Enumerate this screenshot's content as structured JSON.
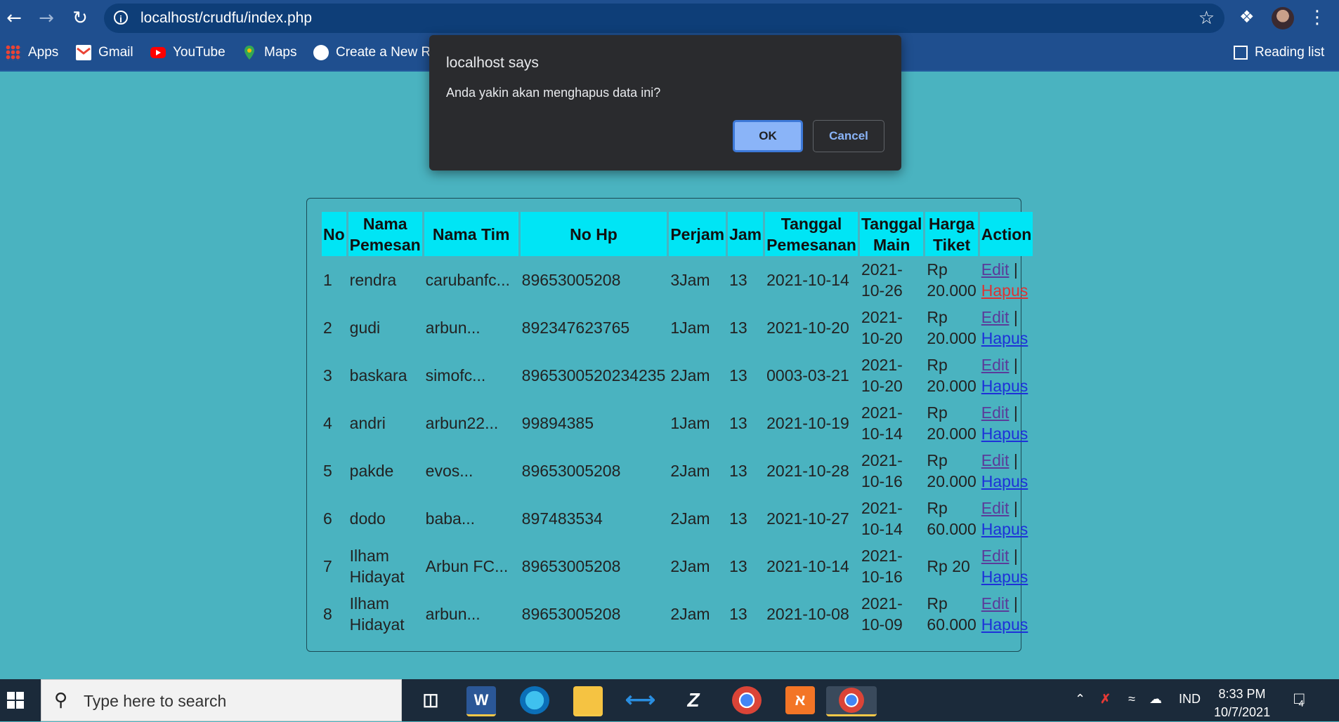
{
  "browser": {
    "url": "localhost/crudfu/index.php",
    "back_icon": "arrow-left-icon",
    "forward_icon": "arrow-right-icon",
    "reload_icon": "reload-icon"
  },
  "bookmarks": {
    "items": [
      {
        "label": "Apps",
        "icon": "apps-grid-icon"
      },
      {
        "label": "Gmail",
        "icon": "gmail-icon"
      },
      {
        "label": "YouTube",
        "icon": "youtube-icon"
      },
      {
        "label": "Maps",
        "icon": "maps-icon"
      },
      {
        "label": "Create a New Re",
        "icon": "github-icon"
      }
    ],
    "reading_list": "Reading list"
  },
  "dialog": {
    "title": "localhost says",
    "message": "Anda yakin akan menghapus data ini?",
    "ok_label": "OK",
    "cancel_label": "Cancel"
  },
  "table": {
    "headers": [
      "No",
      "Nama Pemesan",
      "Nama Tim",
      "No Hp",
      "Perjam",
      "Jam",
      "Tanggal Pemesanan",
      "Tanggal Main",
      "Harga Tiket",
      "Action"
    ],
    "edit_label": "Edit",
    "separator": "|",
    "hapus_label": "Hapus",
    "rows": [
      {
        "no": "1",
        "nama": "rendra",
        "tim": "carubanfc...",
        "hp": "89653005208",
        "perjam": "3Jam",
        "jam": "13",
        "tgl_pesan": "2021-10-14",
        "tgl_main_a": "2021-",
        "tgl_main_b": "10-26",
        "harga_a": "Rp",
        "harga_b": "20.000"
      },
      {
        "no": "2",
        "nama": "gudi",
        "tim": "arbun...",
        "hp": "892347623765",
        "perjam": "1Jam",
        "jam": "13",
        "tgl_pesan": "2021-10-20",
        "tgl_main_a": "2021-",
        "tgl_main_b": "10-20",
        "harga_a": "Rp",
        "harga_b": "20.000"
      },
      {
        "no": "3",
        "nama": "baskara",
        "tim": "simofc...",
        "hp": "8965300520234235",
        "perjam": "2Jam",
        "jam": "13",
        "tgl_pesan": "0003-03-21",
        "tgl_main_a": "2021-",
        "tgl_main_b": "10-20",
        "harga_a": "Rp",
        "harga_b": "20.000"
      },
      {
        "no": "4",
        "nama": "andri",
        "tim": "arbun22...",
        "hp": "99894385",
        "perjam": "1Jam",
        "jam": "13",
        "tgl_pesan": "2021-10-19",
        "tgl_main_a": "2021-",
        "tgl_main_b": "10-14",
        "harga_a": "Rp",
        "harga_b": "20.000"
      },
      {
        "no": "5",
        "nama": "pakde",
        "tim": "evos...",
        "hp": "89653005208",
        "perjam": "2Jam",
        "jam": "13",
        "tgl_pesan": "2021-10-28",
        "tgl_main_a": "2021-",
        "tgl_main_b": "10-16",
        "harga_a": "Rp",
        "harga_b": "20.000"
      },
      {
        "no": "6",
        "nama": "dodo",
        "tim": "baba...",
        "hp": "897483534",
        "perjam": "2Jam",
        "jam": "13",
        "tgl_pesan": "2021-10-27",
        "tgl_main_a": "2021-",
        "tgl_main_b": "10-14",
        "harga_a": "Rp",
        "harga_b": "60.000"
      },
      {
        "no": "7",
        "nama_a": "Ilham",
        "nama_b": "Hidayat",
        "tim": "Arbun FC...",
        "hp": "89653005208",
        "perjam": "2Jam",
        "jam": "13",
        "tgl_pesan": "2021-10-14",
        "tgl_main_a": "2021-",
        "tgl_main_b": "10-16",
        "harga_a": "Rp 20",
        "harga_b": ""
      },
      {
        "no": "8",
        "nama_a": "Ilham",
        "nama_b": "Hidayat",
        "tim": "arbun...",
        "hp": "89653005208",
        "perjam": "2Jam",
        "jam": "13",
        "tgl_pesan": "2021-10-08",
        "tgl_main_a": "2021-",
        "tgl_main_b": "10-09",
        "harga_a": "Rp",
        "harga_b": "60.000"
      }
    ]
  },
  "taskbar": {
    "search_placeholder": "Type here to search",
    "language": "IND",
    "time": "8:33 PM",
    "date": "10/7/2021",
    "notification_count": "4"
  },
  "colors": {
    "page_bg": "#4ab3c0",
    "header_bg": "#00e5f5",
    "chrome_bar": "#1f4f8f",
    "dialog_bg": "#2a2b2e",
    "ok_button": "#8ab4f8"
  }
}
